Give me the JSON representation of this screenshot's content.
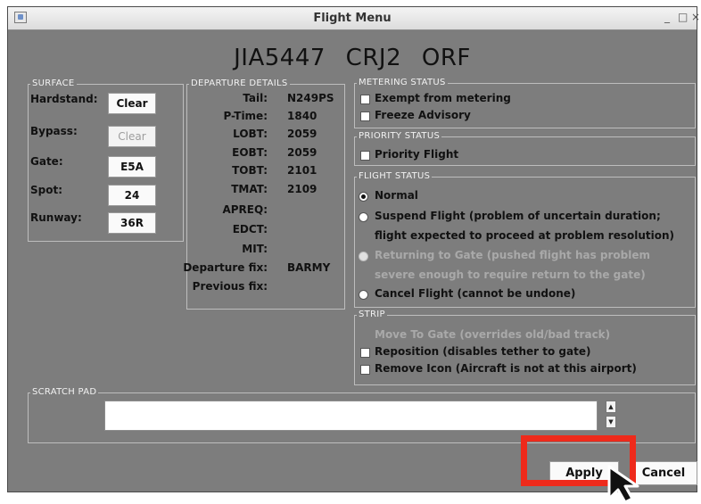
{
  "window": {
    "title": "Flight Menu",
    "controls": {
      "minimize": "_",
      "maximize": "□",
      "close": "×"
    }
  },
  "header": {
    "flight_id": "JIA5447 CRJ2 ORF"
  },
  "surface": {
    "legend": "SURFACE",
    "hardstand_label": "Hardstand:",
    "hardstand_value": "Clear",
    "bypass_label": "Bypass:",
    "bypass_value": "Clear",
    "gate_label": "Gate:",
    "gate_value": "E5A",
    "spot_label": "Spot:",
    "spot_value": "24",
    "runway_label": "Runway:",
    "runway_value": "36R"
  },
  "departure": {
    "legend": "DEPARTURE DETAILS",
    "rows": [
      {
        "label": "Tail:",
        "value": "N249PS"
      },
      {
        "label": "P-Time:",
        "value": "1840"
      },
      {
        "label": "LOBT:",
        "value": "2059"
      },
      {
        "label": "EOBT:",
        "value": "2059"
      },
      {
        "label": "TOBT:",
        "value": "2101"
      },
      {
        "label": "TMAT:",
        "value": "2109"
      },
      {
        "label": "APREQ:",
        "value": ""
      },
      {
        "label": "EDCT:",
        "value": ""
      },
      {
        "label": "MIT:",
        "value": ""
      },
      {
        "label": "Departure fix:",
        "value": "BARMY"
      },
      {
        "label": "Previous fix:",
        "value": ""
      }
    ]
  },
  "metering": {
    "legend": "METERING STATUS",
    "exempt_label": "Exempt from metering",
    "freeze_label": "Freeze Advisory"
  },
  "priority": {
    "legend": "PRIORITY STATUS",
    "priority_label": "Priority Flight"
  },
  "flight_status": {
    "legend": "FLIGHT STATUS",
    "normal_label": "Normal",
    "suspend_label_1": "Suspend Flight (problem of uncertain duration;",
    "suspend_label_2": "flight expected to proceed at problem resolution)",
    "return_label_1": "Returning to Gate (pushed flight has problem",
    "return_label_2": "severe enough to require return to the gate)",
    "cancel_label": "Cancel Flight (cannot be undone)",
    "selected": "Normal"
  },
  "strip": {
    "legend": "STRIP",
    "move_label": "Move To Gate (overrides old/bad track)",
    "reposition_label": "Reposition (disables tether to gate)",
    "remove_label": "Remove Icon (Aircraft is not at this airport)"
  },
  "scratch_pad": {
    "legend": "SCRATCH PAD",
    "value": ""
  },
  "actions": {
    "apply_label": "Apply",
    "cancel_label": "Cancel"
  },
  "colors": {
    "window_bg": "#7d7d7d",
    "highlight": "#ee2a1b"
  }
}
